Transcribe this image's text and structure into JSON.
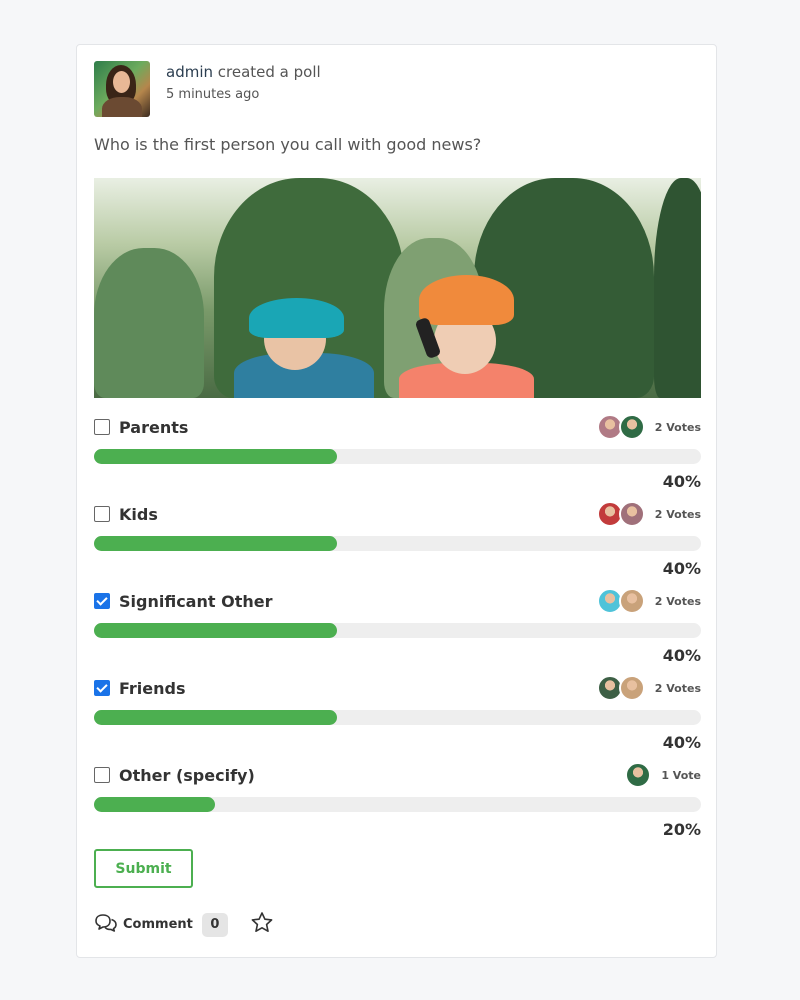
{
  "post": {
    "username": "admin",
    "action": " created a poll",
    "time": "5 minutes ago",
    "question": "Who is the first person you call with good news?"
  },
  "poll": {
    "options": [
      {
        "label": "Parents",
        "checked": false,
        "votes": "2 Votes",
        "percent_text": "40%",
        "percent": 40,
        "voter_colors": [
          "#b07a85",
          "#2f6b45"
        ]
      },
      {
        "label": "Kids",
        "checked": false,
        "votes": "2 Votes",
        "percent_text": "40%",
        "percent": 40,
        "voter_colors": [
          "#c23b3b",
          "#a0707a"
        ]
      },
      {
        "label": "Significant Other",
        "checked": true,
        "votes": "2 Votes",
        "percent_text": "40%",
        "percent": 40,
        "voter_colors": [
          "#4fc3d9",
          "#c9a27a"
        ]
      },
      {
        "label": "Friends",
        "checked": true,
        "votes": "2 Votes",
        "percent_text": "40%",
        "percent": 40,
        "voter_colors": [
          "#3d5f45",
          "#c9a27a"
        ]
      },
      {
        "label": "Other (specify)",
        "checked": false,
        "votes": "1 Vote",
        "percent_text": "20%",
        "percent": 20,
        "voter_colors": [
          "#2f6b45"
        ]
      }
    ]
  },
  "submit_label": "Submit",
  "actions": {
    "comment_label": "Comment",
    "comment_count": "0",
    "comment_icon": "speech-bubbles-icon",
    "favorite_icon": "star-icon"
  },
  "colors": {
    "accent_green": "#4caf50",
    "checkbox_blue": "#1a73e8",
    "track_gray": "#eeeeee"
  }
}
